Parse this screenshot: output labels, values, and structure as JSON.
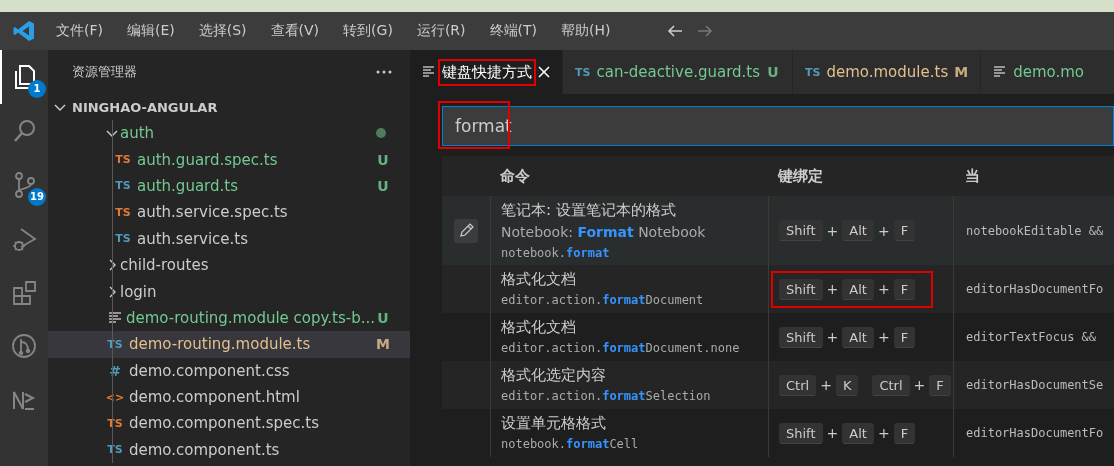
{
  "menu_bar": {
    "items": [
      "文件(F)",
      "编辑(E)",
      "选择(S)",
      "查看(V)",
      "转到(G)",
      "运行(R)",
      "终端(T)",
      "帮助(H)"
    ],
    "nav": [
      {
        "kind": "back",
        "disabled": false
      },
      {
        "kind": "forward",
        "disabled": true
      }
    ]
  },
  "activity_bar": [
    {
      "kind": "explorer",
      "selected": true,
      "badge": "1"
    },
    {
      "kind": "search",
      "selected": false
    },
    {
      "kind": "source-control",
      "selected": false,
      "badge": "19"
    },
    {
      "kind": "run-debug",
      "selected": false
    },
    {
      "kind": "extensions",
      "selected": false
    },
    {
      "kind": "git-graph",
      "selected": false
    },
    {
      "kind": "logo",
      "selected": false
    }
  ],
  "sidebar": {
    "title": "资源管理器",
    "project": {
      "name": "NINGHAO-ANGULAR",
      "expanded": true,
      "children": [
        {
          "name": "auth",
          "kind": "folder",
          "expanded": true,
          "color": "#73c991",
          "dot": true,
          "selected": false,
          "children": [
            {
              "name": "auth.guard.spec.ts",
              "kind": "spec",
              "icon": "TS",
              "color": "#73c991",
              "badge": "U",
              "selected": false
            },
            {
              "name": "auth.guard.ts",
              "kind": "ts",
              "icon": "TS",
              "color": "#73c991",
              "badge": "U",
              "selected": false
            },
            {
              "name": "auth.service.spec.ts",
              "kind": "spec",
              "icon": "TS",
              "color": "#cccccc",
              "selected": false
            },
            {
              "name": "auth.service.ts",
              "kind": "ts",
              "icon": "TS",
              "color": "#cccccc",
              "selected": false
            }
          ]
        },
        {
          "name": "child-routes",
          "kind": "folder",
          "expanded": false,
          "color": "#cccccc",
          "selected": false
        },
        {
          "name": "login",
          "kind": "folder",
          "expanded": false,
          "color": "#cccccc",
          "selected": false
        },
        {
          "name": "demo-routing.module copy.ts-b...",
          "kind": "text",
          "color": "#73c991",
          "badge": "U",
          "selected": false
        },
        {
          "name": "demo-routing.module.ts",
          "kind": "ts",
          "icon": "TS",
          "color": "#e2c08d",
          "badge": "M",
          "selected": true
        },
        {
          "name": "demo.component.css",
          "kind": "css",
          "icon": "#",
          "color": "#cccccc",
          "selected": false
        },
        {
          "name": "demo.component.html",
          "kind": "html",
          "icon": "<>",
          "color": "#cccccc",
          "selected": false
        },
        {
          "name": "demo.component.spec.ts",
          "kind": "spec",
          "icon": "TS",
          "color": "#cccccc",
          "selected": false
        },
        {
          "name": "demo.component.ts",
          "kind": "ts",
          "icon": "TS",
          "color": "#cccccc",
          "selected": false
        }
      ]
    }
  },
  "tabs": [
    {
      "label": "键盘快捷方式",
      "kind": "text",
      "color": "#ffffff",
      "selected": true,
      "annotated": true,
      "closable": true
    },
    {
      "label": "can-deactive.guard.ts",
      "kind": "ts",
      "icon": "TS",
      "color": "#73c991",
      "badge": "U",
      "selected": false,
      "annotated": false,
      "closable": false
    },
    {
      "label": "demo.module.ts",
      "kind": "ts",
      "icon": "TS",
      "color": "#e2c08d",
      "badge": "M",
      "selected": false,
      "annotated": false,
      "closable": false
    },
    {
      "label": "demo.mo",
      "kind": "text",
      "color": "#73c991",
      "selected": false,
      "annotated": false,
      "closable": false
    }
  ],
  "search": {
    "value": "format",
    "focused": true,
    "annotated": true
  },
  "table": {
    "columns": [
      "命令",
      "键绑定",
      "当"
    ],
    "key_separator": "+",
    "rows": [
      {
        "title": "笔记本: 设置笔记本的格式",
        "subtitle": "Notebook: **Format** Notebook",
        "command": "notebook.**format**",
        "keys": [
          [
            "Shift",
            "Alt",
            "F"
          ]
        ],
        "when": "notebookEditable &&",
        "selected": true,
        "annotated": false
      },
      {
        "title": "格式化文档",
        "command": "editor.action.**format**Document",
        "keys": [
          [
            "Shift",
            "Alt",
            "F"
          ]
        ],
        "when": "editorHasDocumentFo",
        "selected": false,
        "annotated": true
      },
      {
        "title": "格式化文档",
        "command": "editor.action.**format**Document.none",
        "keys": [
          [
            "Shift",
            "Alt",
            "F"
          ]
        ],
        "when": "editorTextFocus &&",
        "selected": false,
        "annotated": false
      },
      {
        "title": "格式化选定内容",
        "command": "editor.action.**format**Selection",
        "keys": [
          [
            "Ctrl",
            "K"
          ],
          [
            "Ctrl",
            "F"
          ]
        ],
        "when": "editorHasDocumentSe",
        "selected": false,
        "annotated": false
      },
      {
        "title": "设置单元格格式",
        "command": "notebook.**format**Cell",
        "keys": [
          [
            "Shift",
            "Alt",
            "F"
          ]
        ],
        "when": "editorHasDocumentFo",
        "selected": false,
        "annotated": false
      }
    ]
  }
}
